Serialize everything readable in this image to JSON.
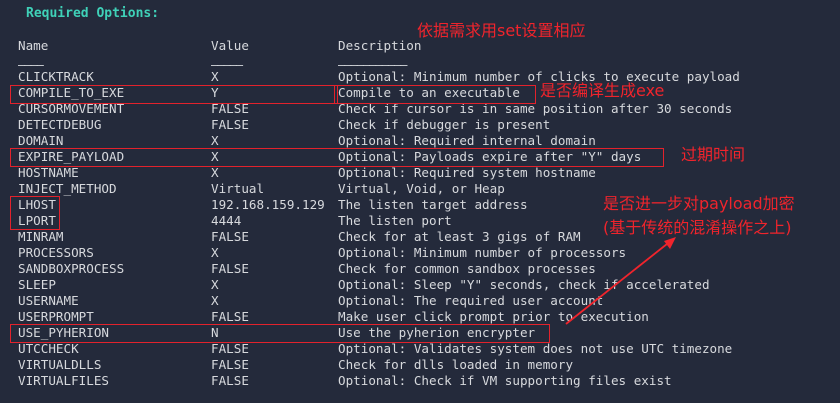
{
  "heading": "Required Options:",
  "columns": {
    "name": "Name",
    "value": "Value",
    "description": "Description",
    "name_underline": "————",
    "value_underline": "—————",
    "description_underline": "———————————"
  },
  "rows": [
    {
      "name": "CLICKTRACK",
      "value": "X",
      "description": "Optional: Minimum number of clicks to execute payload"
    },
    {
      "name": "COMPILE_TO_EXE",
      "value": "Y",
      "description": "Compile to an executable"
    },
    {
      "name": "CURSORMOVEMENT",
      "value": "FALSE",
      "description": "Check if cursor is in same position after 30 seconds"
    },
    {
      "name": "DETECTDEBUG",
      "value": "FALSE",
      "description": "Check if debugger is present"
    },
    {
      "name": "DOMAIN",
      "value": "X",
      "description": "Optional: Required internal domain"
    },
    {
      "name": "EXPIRE_PAYLOAD",
      "value": "X",
      "description": "Optional: Payloads expire after \"Y\" days"
    },
    {
      "name": "HOSTNAME",
      "value": "X",
      "description": "Optional: Required system hostname"
    },
    {
      "name": "INJECT_METHOD",
      "value": "Virtual",
      "description": "Virtual, Void, or Heap"
    },
    {
      "name": "LHOST",
      "value": "192.168.159.129",
      "description": "The listen target address"
    },
    {
      "name": "LPORT",
      "value": "4444",
      "description": "The listen port"
    },
    {
      "name": "MINRAM",
      "value": "FALSE",
      "description": "Check for at least 3 gigs of RAM"
    },
    {
      "name": "PROCESSORS",
      "value": "X",
      "description": "Optional: Minimum number of processors"
    },
    {
      "name": "SANDBOXPROCESS",
      "value": "FALSE",
      "description": "Check for common sandbox processes"
    },
    {
      "name": "SLEEP",
      "value": "X",
      "description": "Optional: Sleep \"Y\" seconds, check if accelerated"
    },
    {
      "name": "USERNAME",
      "value": "X",
      "description": "Optional: The required user account"
    },
    {
      "name": "USERPROMPT",
      "value": "FALSE",
      "description": "Make user click prompt prior to execution"
    },
    {
      "name": "USE_PYHERION",
      "value": "N",
      "description": "Use the pyherion encrypter"
    },
    {
      "name": "UTCCHECK",
      "value": "FALSE",
      "description": "Optional: Validates system does not use UTC timezone"
    },
    {
      "name": "VIRTUALDLLS",
      "value": "FALSE",
      "description": "Check for dlls loaded in memory"
    },
    {
      "name": "VIRTUALFILES",
      "value": "FALSE",
      "description": "Optional: Check if VM supporting files exist"
    }
  ],
  "annotations": {
    "top": "依据需求用set设置相应",
    "compile": "是否编译生成exe",
    "expire": "过期时间",
    "pyherion_line1": "是否进一步对payload加密",
    "pyherion_line2": "(基于传统的混淆操作之上)"
  },
  "colors": {
    "background": "#242a3b",
    "heading": "#3fd1b8",
    "text": "#d7d9dd",
    "annotation": "#f0242c"
  }
}
